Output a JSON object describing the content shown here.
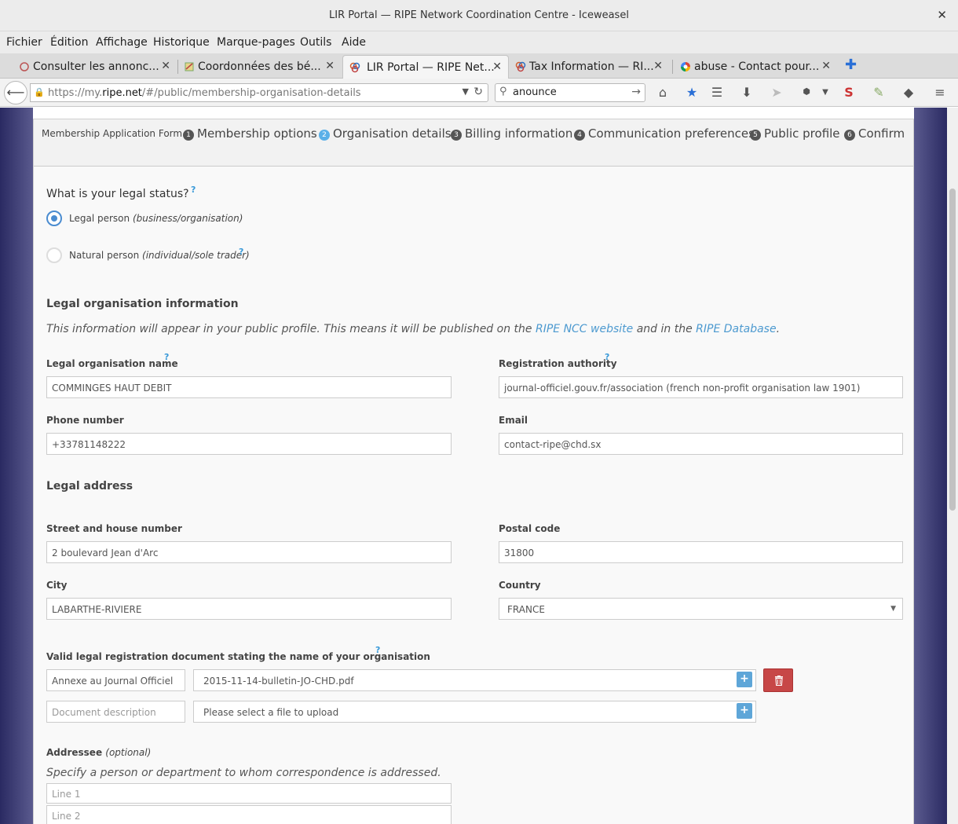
{
  "window": {
    "title": "LIR Portal — RIPE Network Coordination Centre - Iceweasel",
    "close": "✕"
  },
  "menu": [
    "Fichier",
    "Édition",
    "Affichage",
    "Historique",
    "Marque-pages",
    "Outils",
    "Aide"
  ],
  "tabs": [
    {
      "label": "Consulter les annonc...",
      "close": "✕"
    },
    {
      "label": "Coordonnées des bé...",
      "close": "✕"
    },
    {
      "label": "LIR Portal — RIPE Net...",
      "close": "✕"
    },
    {
      "label": "Tax Information — RI...",
      "close": "✕"
    },
    {
      "label": "abuse - Contact pour...",
      "close": "✕"
    }
  ],
  "nav": {
    "url_prefix": "https://my.",
    "url_host": "ripe.net",
    "url_path": "/#/public/membership-organisation-details",
    "search_value": "anounce"
  },
  "form": {
    "title": "Membership Application Form",
    "steps": [
      {
        "num": "1",
        "label": "Membership options"
      },
      {
        "num": "2",
        "label": "Organisation details"
      },
      {
        "num": "3",
        "label": "Billing information"
      },
      {
        "num": "4",
        "label": "Communication preferences"
      },
      {
        "num": "5",
        "label": "Public profile"
      },
      {
        "num": "6",
        "label": "Confirm"
      }
    ],
    "help": "?",
    "legal_status_question": "What is your legal status?",
    "legal_person": "Legal person ",
    "legal_person_note": "(business/organisation)",
    "natural_person": "Natural person ",
    "natural_person_note": "(individual/sole trader)",
    "org_info_heading": "Legal organisation information",
    "info_text_1": "This information will appear in your public profile. This means it will be published on the ",
    "info_link_1": "RIPE NCC website",
    "info_text_2": " and in the ",
    "info_link_2": "RIPE Database",
    "info_text_3": ".",
    "org_name_label": "Legal organisation name",
    "org_name_value": "COMMINGES HAUT DEBIT",
    "reg_authority_label": "Registration authority",
    "reg_authority_value": "journal-officiel.gouv.fr/association (french non-profit organisation law 1901)",
    "phone_label": "Phone number",
    "phone_value": "+33781148222",
    "email_label": "Email",
    "email_value": "contact-ripe@chd.sx",
    "legal_address_heading": "Legal address",
    "street_label": "Street and house number",
    "street_value": "2 boulevard Jean d'Arc",
    "postal_label": "Postal code",
    "postal_value": "31800",
    "city_label": "City",
    "city_value": "LABARTHE-RIVIERE",
    "country_label": "Country",
    "country_value": "FRANCE",
    "doc_label": "Valid legal registration document stating the name of your organisation",
    "doc1_desc": "Annexe au Journal Officiel",
    "doc1_file": "2015-11-14-bulletin-JO-CHD.pdf",
    "doc2_desc_placeholder": "Document description",
    "doc2_file_placeholder": "Please select a file to upload",
    "addressee_label": "Addressee ",
    "addressee_optional": "(optional)",
    "addressee_text": "Specify a person or department to whom correspondence is addressed.",
    "line1_placeholder": "Line 1",
    "line2_placeholder": "Line 2"
  }
}
